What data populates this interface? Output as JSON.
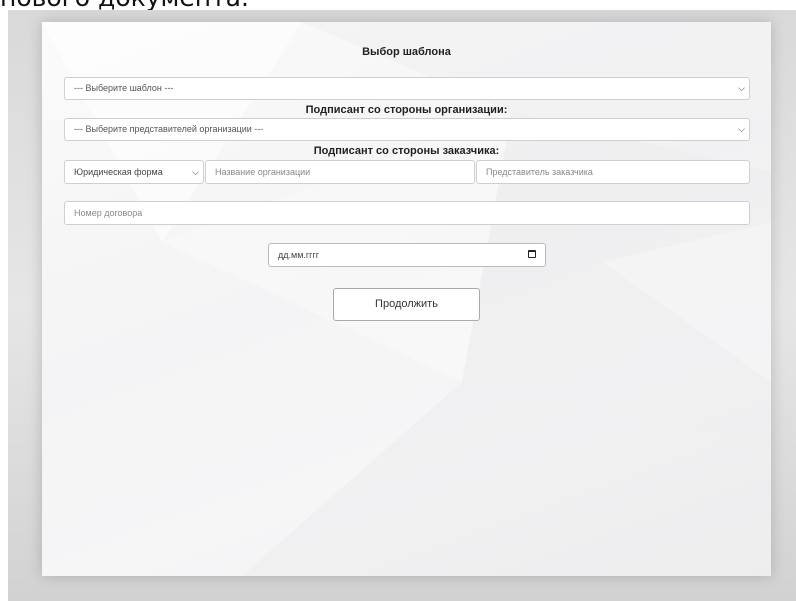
{
  "header_fragment": "нового документа.",
  "form": {
    "title": "Выбор шаблона",
    "template_select": {
      "value": "--- Выберите шаблон ---"
    },
    "org_signer_label": "Подписант со стороны организации:",
    "org_rep_select": {
      "value": "--- Выберите представителей организации ---"
    },
    "customer_signer_label": "Подписант со стороны заказчика:",
    "legal_form_select": {
      "value": "Юридическая форма"
    },
    "org_name_input": {
      "placeholder": "Название организации"
    },
    "customer_rep_input": {
      "placeholder": "Представитель заказчика"
    },
    "contract_number_input": {
      "placeholder": "Номер договора"
    },
    "date_input": {
      "placeholder": "дд.мм.гггг"
    },
    "continue_button": "Продолжить"
  }
}
